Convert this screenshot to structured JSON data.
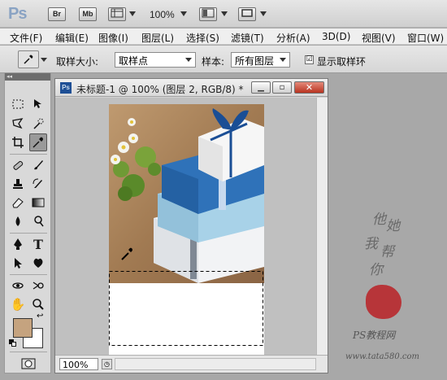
{
  "app": {
    "logo": "Ps",
    "bridge": "Br",
    "minibridge": "Mb",
    "zoom": "100%"
  },
  "menu": [
    "文件(F)",
    "编辑(E)",
    "图像(I)",
    "图层(L)",
    "选择(S)",
    "滤镜(T)",
    "分析(A)",
    "3D(D)",
    "视图(V)",
    "窗口(W)"
  ],
  "options": {
    "sample_size_label": "取样大小:",
    "sample_size_value": "取样点",
    "sample_label": "样本:",
    "sample_value": "所有图层",
    "show_ring_label": "显示取样环",
    "show_ring_checked": "☑"
  },
  "toolbox": {
    "collapse": "◂◂",
    "fg_color": "#c5a37f",
    "bg_color": "#ffffff"
  },
  "document": {
    "ps_icon": "Ps",
    "title": "未标题-1 @ 100% (图层 2, RGB/8) *",
    "zoom": "100%",
    "minimize": "▁",
    "maximize": "▫",
    "close": "✕"
  },
  "watermark": {
    "c1": "他",
    "c2": "她",
    "c3": "我",
    "c4": "帮",
    "c5": "你",
    "site_name": "PS教程网",
    "url": "www.tata580.com"
  }
}
